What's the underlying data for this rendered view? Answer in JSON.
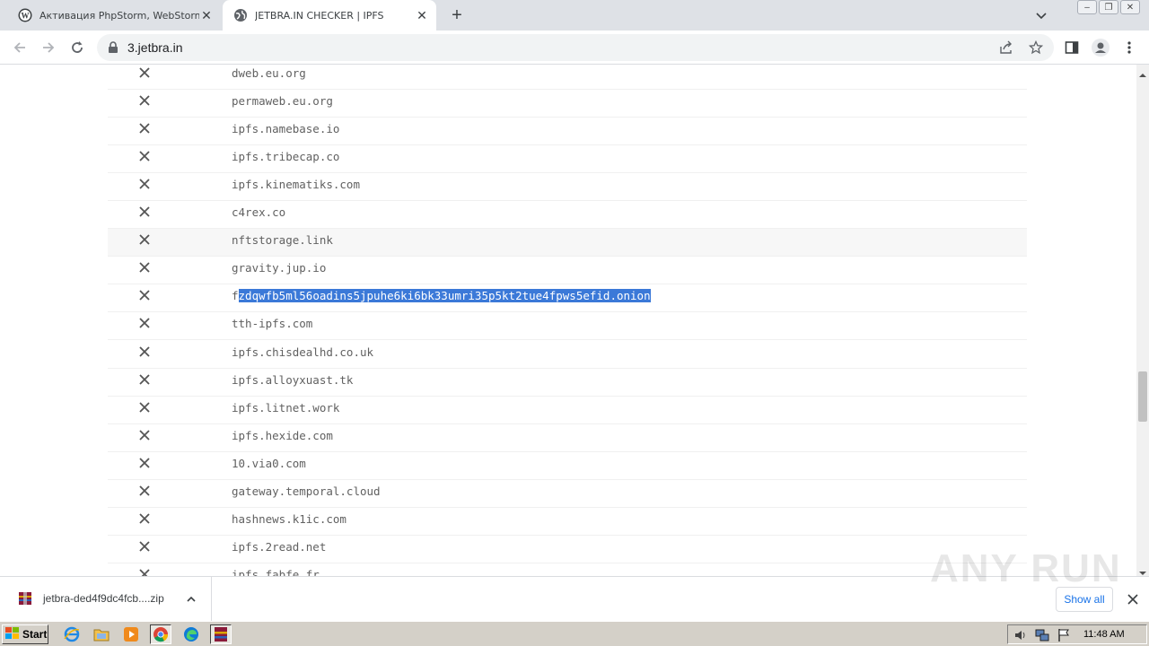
{
  "tabs": [
    {
      "title": "Активация PhpStorm, WebStorm, Intel",
      "icon": "wordpress-icon",
      "active": false
    },
    {
      "title": "JETBRA.IN CHECKER | IPFS",
      "icon": "globe-icon",
      "active": true
    }
  ],
  "address_bar": {
    "url": "3.jetbra.in"
  },
  "hosts": [
    {
      "name": "dweb.eu.org",
      "status": "fail"
    },
    {
      "name": "permaweb.eu.org",
      "status": "fail"
    },
    {
      "name": "ipfs.namebase.io",
      "status": "fail"
    },
    {
      "name": "ipfs.tribecap.co",
      "status": "fail"
    },
    {
      "name": "ipfs.kinematiks.com",
      "status": "fail"
    },
    {
      "name": "c4rex.co",
      "status": "fail"
    },
    {
      "name": "nftstorage.link",
      "status": "fail"
    },
    {
      "name": "gravity.jup.io",
      "status": "fail"
    },
    {
      "name": "fzdqwfb5ml56oadins5jpuhe6ki6bk33umri35p5kt2tue4fpws5efid.onion",
      "status": "fail",
      "selected_prefix": "f",
      "selected_text": "zdqwfb5ml56oadins5jpuhe6ki6bk33umri35p5kt2tue4fpws5efid.onion"
    },
    {
      "name": "tth-ipfs.com",
      "status": "fail"
    },
    {
      "name": "ipfs.chisdealhd.co.uk",
      "status": "fail"
    },
    {
      "name": "ipfs.alloyxuast.tk",
      "status": "fail"
    },
    {
      "name": "ipfs.litnet.work",
      "status": "fail"
    },
    {
      "name": "ipfs.hexide.com",
      "status": "fail"
    },
    {
      "name": "10.via0.com",
      "status": "fail"
    },
    {
      "name": "gateway.temporal.cloud",
      "status": "fail"
    },
    {
      "name": "hashnews.k1ic.com",
      "status": "fail"
    },
    {
      "name": "ipfs.2read.net",
      "status": "fail"
    },
    {
      "name": "ipfs.fabfe.fr",
      "status": "fail"
    }
  ],
  "downloads": {
    "file_name": "jetbra-ded4f9dc4fcb....zip",
    "show_all_label": "Show all"
  },
  "watermark": "ANY RUN",
  "taskbar": {
    "start_label": "Start",
    "clock": "11:48 AM"
  }
}
